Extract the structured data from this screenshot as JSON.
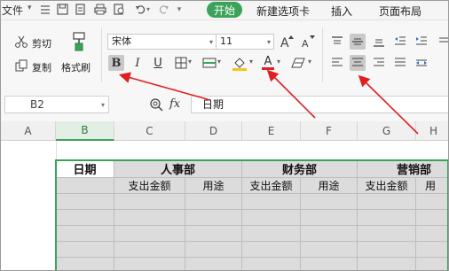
{
  "menubar": {
    "file_label": "文件",
    "tabs": [
      "开始",
      "新建选项卡",
      "插入",
      "页面布局"
    ],
    "active_tab": "开始",
    "accent_color": "#3aa359"
  },
  "ribbon": {
    "cut_label": "剪切",
    "copy_label": "复制",
    "format_painter_label": "格式刷",
    "font_name": "宋体",
    "font_size": "11",
    "bold_glyph": "B",
    "italic_glyph": "I",
    "underline_glyph": "U",
    "font_color_glyph": "A"
  },
  "formula_bar": {
    "cell_ref": "B2",
    "fx_label": "fx",
    "content": "日期"
  },
  "sheet": {
    "columns": [
      "A",
      "B",
      "C",
      "D",
      "E",
      "F",
      "G",
      "H"
    ],
    "selected_column": "B",
    "header_row": {
      "date": "日期",
      "hr": "人事部",
      "finance": "财务部",
      "sales": "营销部"
    },
    "sub_row": [
      "支出金额",
      "用途",
      "支出金额",
      "用途",
      "支出金额",
      "用"
    ]
  },
  "annotations": {
    "arrow_color": "#e02020"
  }
}
